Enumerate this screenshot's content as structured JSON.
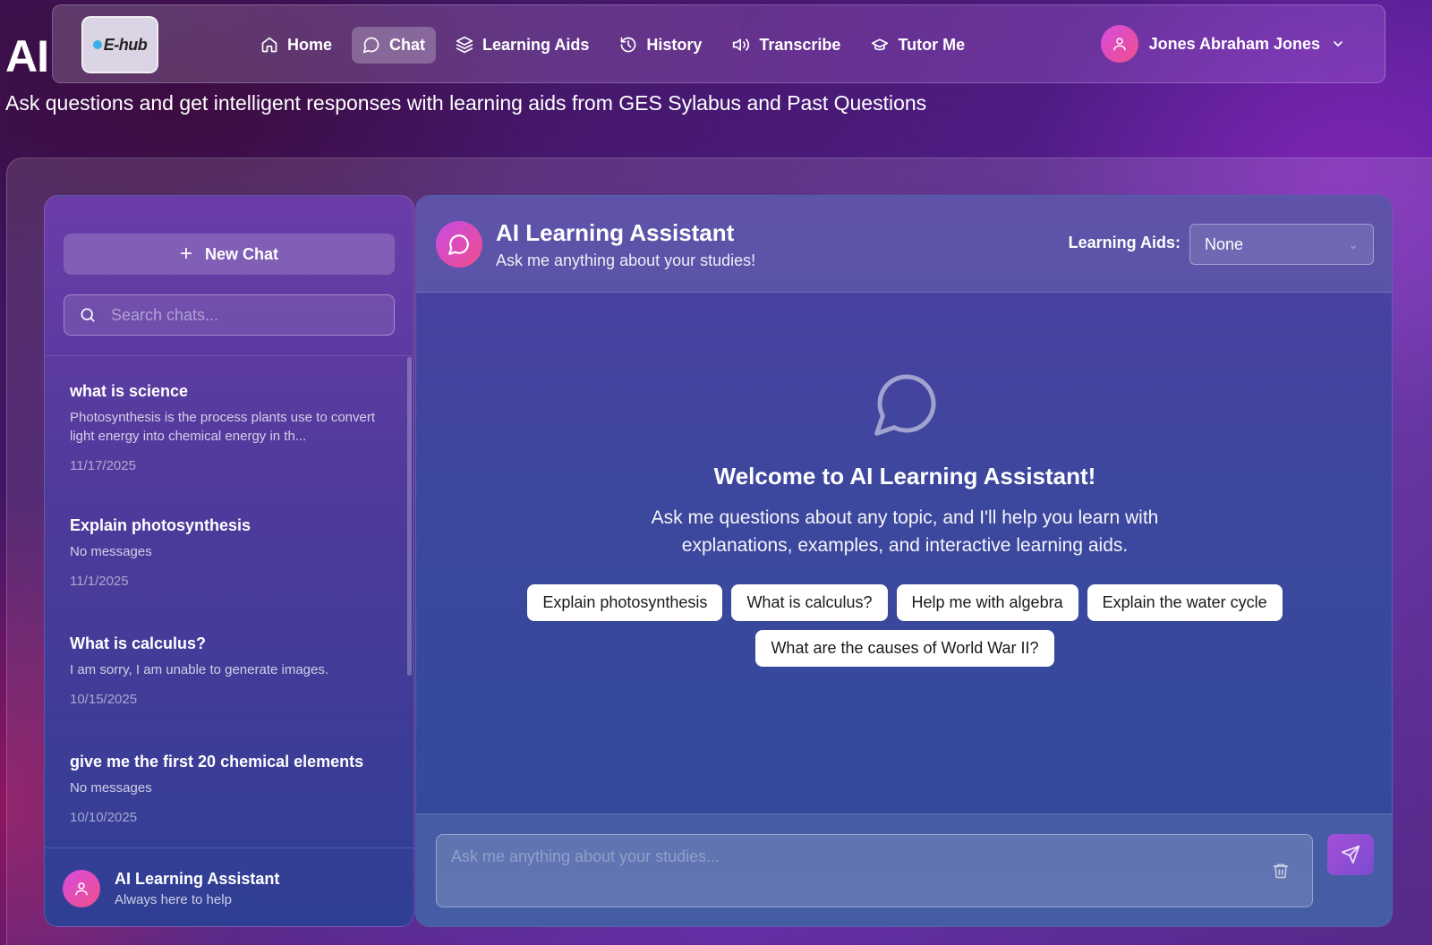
{
  "brand": {
    "big_label": "AI",
    "logo_text": "E-hub"
  },
  "nav": {
    "items": [
      {
        "label": "Home",
        "icon": "home-icon"
      },
      {
        "label": "Chat",
        "icon": "chat-bubble-icon",
        "active": true
      },
      {
        "label": "Learning Aids",
        "icon": "layers-icon"
      },
      {
        "label": "History",
        "icon": "history-icon"
      },
      {
        "label": "Transcribe",
        "icon": "speaker-icon"
      },
      {
        "label": "Tutor Me",
        "icon": "graduation-cap-icon"
      }
    ],
    "user_name": "Jones Abraham Jones"
  },
  "page": {
    "subtitle": "Ask questions and get intelligent responses with learning aids from GES Sylabus and Past Questions"
  },
  "sidebar": {
    "new_chat_label": "New Chat",
    "search_placeholder": "Search chats...",
    "chats": [
      {
        "title": "what is science",
        "preview": "Photosynthesis is the process plants use to convert light energy into chemical energy in th...",
        "date": "11/17/2025"
      },
      {
        "title": "Explain photosynthesis",
        "preview": "No messages",
        "date": "11/1/2025"
      },
      {
        "title": "What is calculus?",
        "preview": "I am sorry, I am unable to generate images.",
        "date": "10/15/2025"
      },
      {
        "title": "give me the first 20 chemical elements",
        "preview": "No messages",
        "date": "10/10/2025"
      }
    ],
    "footer_name": "AI Learning Assistant",
    "footer_tagline": "Always here to help"
  },
  "main": {
    "title": "AI Learning Assistant",
    "subtitle": "Ask me anything about your studies!",
    "aids_label": "Learning Aids:",
    "aids_value": "None",
    "welcome_title": "Welcome to AI Learning Assistant!",
    "welcome_text": "Ask me questions about any topic, and I'll help you learn with explanations, examples, and interactive learning aids.",
    "suggestions": [
      "Explain photosynthesis",
      "What is calculus?",
      "Help me with algebra",
      "Explain the water cycle",
      "What are the causes of World War II?"
    ],
    "input_placeholder": "Ask me anything about your studies..."
  },
  "colors": {
    "accent_gradient_start": "#d64be0",
    "accent_gradient_end": "#f0508a",
    "chip_background": "#ffffff"
  }
}
